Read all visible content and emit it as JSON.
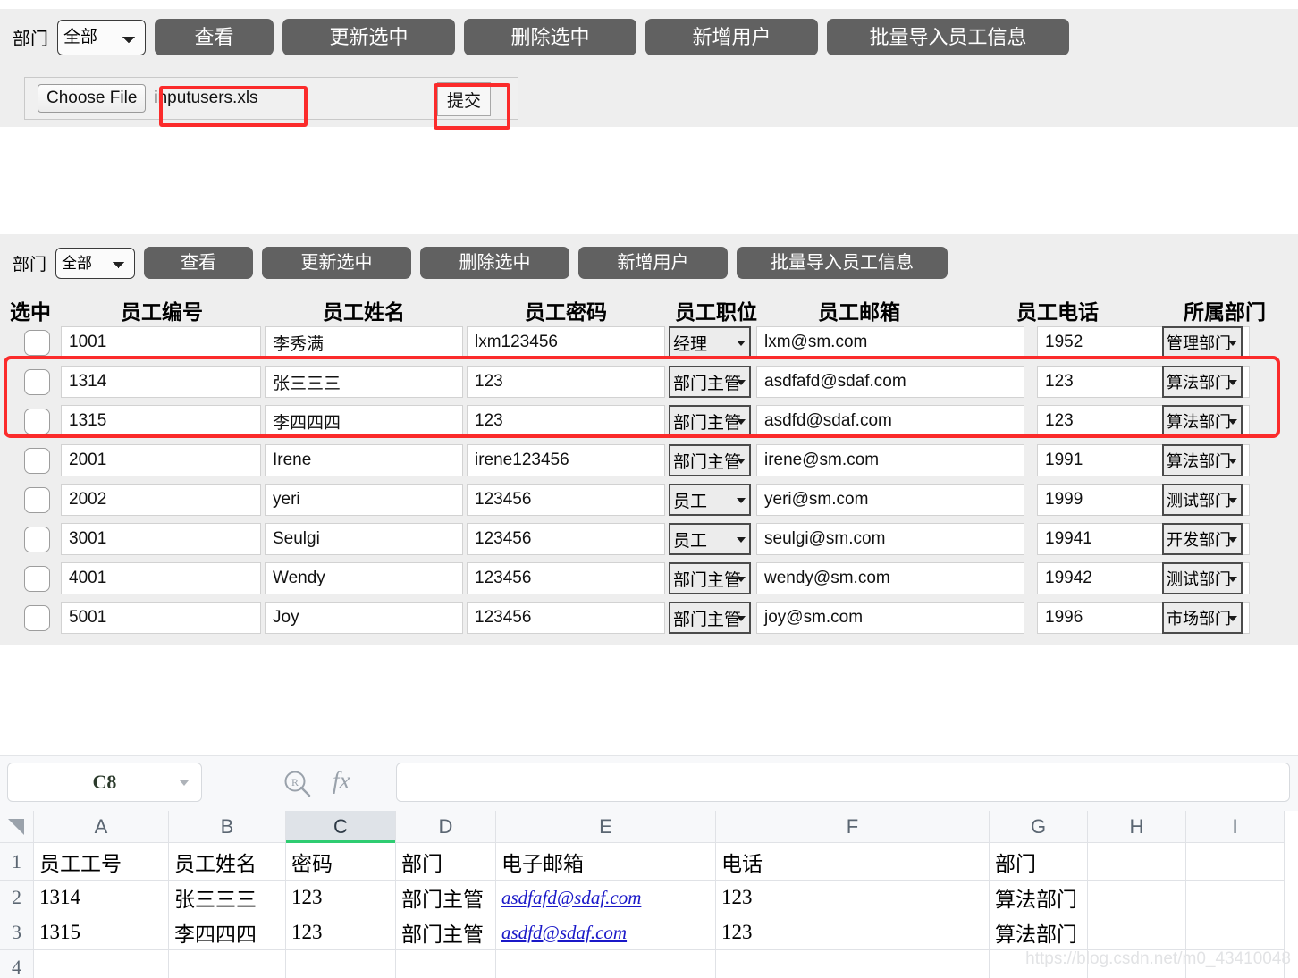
{
  "import_panel": {
    "dept_label": "部门",
    "dept_select": {
      "value": "全部",
      "options": [
        "全部"
      ]
    },
    "buttons": [
      {
        "label": "查看",
        "name": "view-button"
      },
      {
        "label": "更新选中",
        "name": "update-selected-button"
      },
      {
        "label": "删除选中",
        "name": "delete-selected-button"
      },
      {
        "label": "新增用户",
        "name": "add-user-button"
      },
      {
        "label": "批量导入员工信息",
        "name": "batch-import-button"
      }
    ],
    "file_input": {
      "choose_label": "Choose File",
      "file_name": "inputusers.xls"
    },
    "submit_label": "提交"
  },
  "list_panel": {
    "dept_label": "部门",
    "dept_select": {
      "value": "全部",
      "options": [
        "全部"
      ]
    },
    "buttons": [
      {
        "label": "查看",
        "name": "view-button"
      },
      {
        "label": "更新选中",
        "name": "update-selected-button"
      },
      {
        "label": "删除选中",
        "name": "delete-selected-button"
      },
      {
        "label": "新增用户",
        "name": "add-user-button"
      },
      {
        "label": "批量导入员工信息",
        "name": "batch-import-button"
      }
    ],
    "columns": [
      "选中",
      "员工编号",
      "员工姓名",
      "员工密码",
      "员工职位",
      "员工邮箱",
      "员工电话",
      "所属部门"
    ],
    "rows": [
      {
        "checked": false,
        "id": "1001",
        "name": "李秀满",
        "password": "lxm123456",
        "position": "经理",
        "email": "lxm@sm.com",
        "phone": "1952",
        "dept": "管理部门"
      },
      {
        "checked": false,
        "id": "1314",
        "name": "张三三三",
        "password": "123",
        "position": "部门主管",
        "email": "asdfafd@sdaf.com",
        "phone": "123",
        "dept": "算法部门"
      },
      {
        "checked": false,
        "id": "1315",
        "name": "李四四四",
        "password": "123",
        "position": "部门主管",
        "email": "asdfd@sdaf.com",
        "phone": "123",
        "dept": "算法部门"
      },
      {
        "checked": false,
        "id": "2001",
        "name": "Irene",
        "password": "irene123456",
        "position": "部门主管",
        "email": "irene@sm.com",
        "phone": "1991",
        "dept": "算法部门"
      },
      {
        "checked": false,
        "id": "2002",
        "name": "yeri",
        "password": "123456",
        "position": "员工",
        "email": "yeri@sm.com",
        "phone": "1999",
        "dept": "测试部门"
      },
      {
        "checked": false,
        "id": "3001",
        "name": "Seulgi",
        "password": "123456",
        "position": "员工",
        "email": "seulgi@sm.com",
        "phone": "19941",
        "dept": "开发部门"
      },
      {
        "checked": false,
        "id": "4001",
        "name": "Wendy",
        "password": "123456",
        "position": "部门主管",
        "email": "wendy@sm.com",
        "phone": "19942",
        "dept": "测试部门"
      },
      {
        "checked": false,
        "id": "5001",
        "name": "Joy",
        "password": "123456",
        "position": "部门主管",
        "email": "joy@sm.com",
        "phone": "1996",
        "dept": "市场部门"
      }
    ]
  },
  "spreadsheet": {
    "name_box": "C8",
    "formula_bar": "",
    "search_icon": "search-r-icon",
    "fx_icon": "fx",
    "selected_column": "C",
    "column_headers": [
      "A",
      "B",
      "C",
      "D",
      "E",
      "F",
      "G",
      "H",
      "I"
    ],
    "row_headers": [
      "1",
      "2",
      "3",
      "4"
    ],
    "cells": [
      [
        "员工工号",
        "员工姓名",
        "密码",
        "部门",
        "电子邮箱",
        "电话",
        "部门",
        "",
        ""
      ],
      [
        "1314",
        "张三三三",
        "123",
        "部门主管",
        "asdfafd@sdaf.com",
        "123",
        "算法部门",
        "",
        ""
      ],
      [
        "1315",
        "李四四四",
        "123",
        "部门主管",
        "asdfd@sdaf.com",
        "123",
        "算法部门",
        "",
        ""
      ],
      [
        "",
        "",
        "",
        "",
        "",
        "",
        "",
        "",
        ""
      ]
    ],
    "email_cells": [
      "asdfafd@sdaf.com",
      "asdfd@sdaf.com"
    ]
  },
  "watermark": "https://blog.csdn.net/m0_43410048",
  "colors": {
    "panel_bg": "#eeeeee",
    "button_bg": "#616161",
    "highlight_red": "#fb2b2b",
    "sheet_accent_green": "#2ecc71",
    "link_blue": "#1a18c8"
  }
}
